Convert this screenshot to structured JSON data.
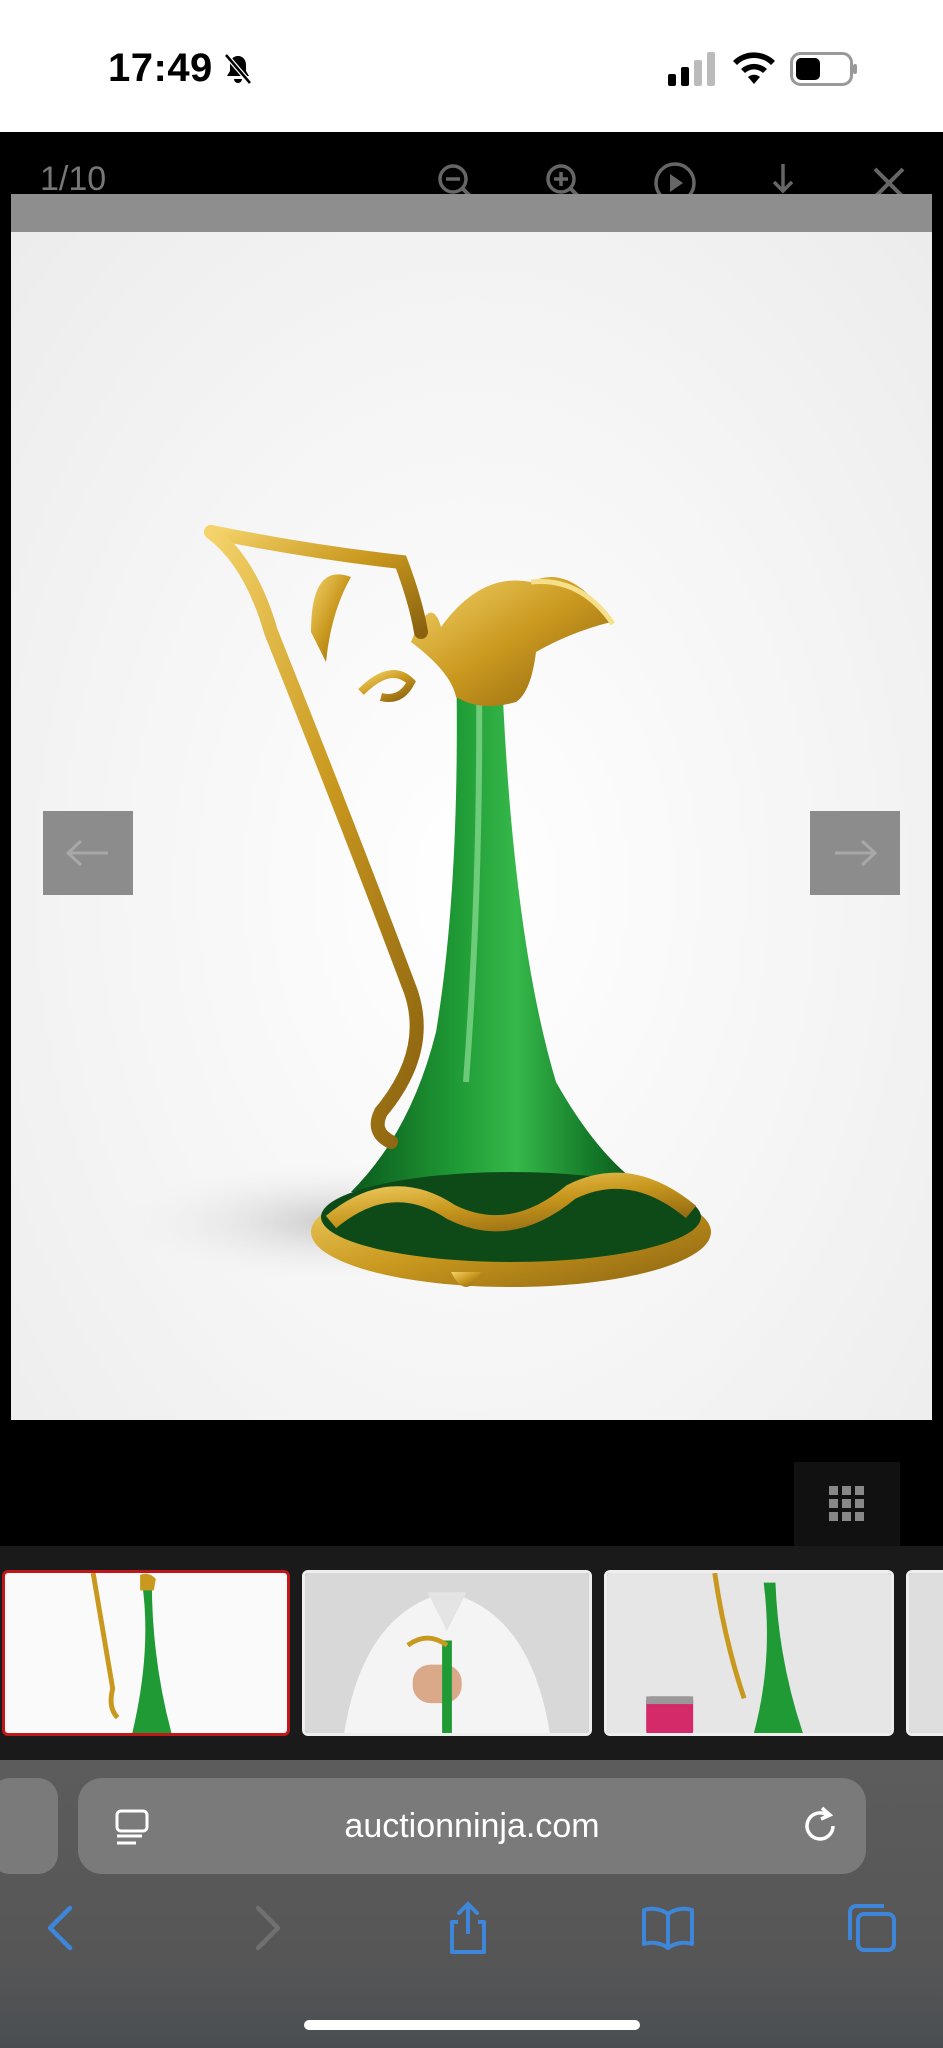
{
  "status": {
    "time": "17:49"
  },
  "viewer": {
    "counter": "1/10",
    "toolbar": [
      "zoom-out",
      "zoom-in",
      "play",
      "download",
      "close"
    ]
  },
  "browser": {
    "url": "auctionninja.com"
  },
  "colors": {
    "accent_blue": "#3d86d9",
    "thumb_selected_border": "#c0181a",
    "viewer_bg": "#000000"
  },
  "thumbnails": {
    "count_visible": 4,
    "selected_index": 0
  }
}
